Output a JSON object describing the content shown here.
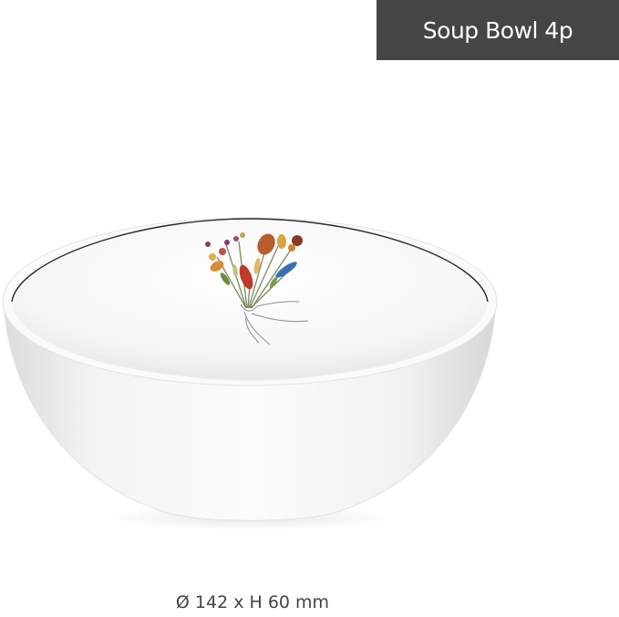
{
  "header": {
    "title": "Soup Bowl 4p"
  },
  "product": {
    "illustration": "white-porcelain-soup-bowl-floral-bouquet",
    "dimensions_text": "Ø 142 x H 60 mm"
  },
  "colors": {
    "badge_background": "#454545",
    "badge_text": "#ffffff",
    "bowl_rim_line": "#2a2a2a",
    "dimensions_text": "#444444"
  }
}
